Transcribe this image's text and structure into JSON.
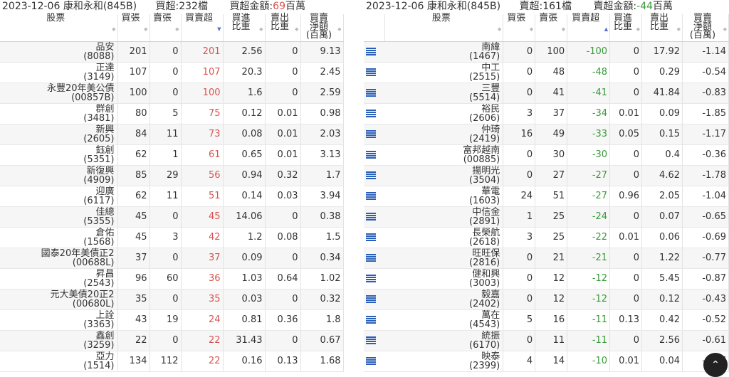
{
  "left": {
    "date": "2023-12-06",
    "broker": "康和永和(845B)",
    "summary": "買超:232檔",
    "amount_label": "買超金額:",
    "amount_value": "69",
    "amount_unit": "百萬",
    "headers": [
      "股票",
      "買張",
      "賣張",
      "買賣超",
      "買進\n比重",
      "賣出\n比重",
      "買賣\n淨額\n(百萬)"
    ],
    "rows": [
      {
        "name": "品安",
        "code": "(8088)",
        "buy": "201",
        "sell": "0",
        "net": "201",
        "buy_ratio": "2.56",
        "sell_ratio": "0",
        "amount": "9.13"
      },
      {
        "name": "正達",
        "code": "(3149)",
        "buy": "107",
        "sell": "0",
        "net": "107",
        "buy_ratio": "20.3",
        "sell_ratio": "0",
        "amount": "2.45"
      },
      {
        "name": "永豐20年美公債",
        "code": "(00857B)",
        "buy": "100",
        "sell": "0",
        "net": "100",
        "buy_ratio": "1.6",
        "sell_ratio": "0",
        "amount": "2.59"
      },
      {
        "name": "群創",
        "code": "(3481)",
        "buy": "80",
        "sell": "5",
        "net": "75",
        "buy_ratio": "0.12",
        "sell_ratio": "0.01",
        "amount": "0.98"
      },
      {
        "name": "新興",
        "code": "(2605)",
        "buy": "84",
        "sell": "11",
        "net": "73",
        "buy_ratio": "0.08",
        "sell_ratio": "0.01",
        "amount": "2.03"
      },
      {
        "name": "鈺創",
        "code": "(5351)",
        "buy": "62",
        "sell": "1",
        "net": "61",
        "buy_ratio": "0.65",
        "sell_ratio": "0.01",
        "amount": "3.13"
      },
      {
        "name": "新復興",
        "code": "(4909)",
        "buy": "85",
        "sell": "29",
        "net": "56",
        "buy_ratio": "0.94",
        "sell_ratio": "0.32",
        "amount": "1.7"
      },
      {
        "name": "迎廣",
        "code": "(6117)",
        "buy": "62",
        "sell": "11",
        "net": "51",
        "buy_ratio": "0.14",
        "sell_ratio": "0.03",
        "amount": "3.94"
      },
      {
        "name": "佳總",
        "code": "(5355)",
        "buy": "45",
        "sell": "0",
        "net": "45",
        "buy_ratio": "14.06",
        "sell_ratio": "0",
        "amount": "0.38"
      },
      {
        "name": "倉佑",
        "code": "(1568)",
        "buy": "45",
        "sell": "3",
        "net": "42",
        "buy_ratio": "1.2",
        "sell_ratio": "0.08",
        "amount": "1.5"
      },
      {
        "name": "國泰20年美債正2",
        "code": "(00688L)",
        "buy": "37",
        "sell": "0",
        "net": "37",
        "buy_ratio": "0.09",
        "sell_ratio": "0",
        "amount": "0.34"
      },
      {
        "name": "昇昌",
        "code": "(2543)",
        "buy": "96",
        "sell": "60",
        "net": "36",
        "buy_ratio": "1.03",
        "sell_ratio": "0.64",
        "amount": "1.02"
      },
      {
        "name": "元大美債20正2",
        "code": "(00680L)",
        "buy": "35",
        "sell": "0",
        "net": "35",
        "buy_ratio": "0.03",
        "sell_ratio": "0",
        "amount": "0.32"
      },
      {
        "name": "上詮",
        "code": "(3363)",
        "buy": "43",
        "sell": "19",
        "net": "24",
        "buy_ratio": "0.81",
        "sell_ratio": "0.36",
        "amount": "1.8"
      },
      {
        "name": "鑫創",
        "code": "(3259)",
        "buy": "22",
        "sell": "0",
        "net": "22",
        "buy_ratio": "31.43",
        "sell_ratio": "0",
        "amount": "0.67"
      },
      {
        "name": "亞力",
        "code": "(1514)",
        "buy": "134",
        "sell": "112",
        "net": "22",
        "buy_ratio": "0.16",
        "sell_ratio": "0.13",
        "amount": "1.68"
      }
    ]
  },
  "right": {
    "date": "2023-12-06",
    "broker": "康和永和(845B)",
    "summary": "賣超:161檔",
    "amount_label": "賣超金額:",
    "amount_value": "-44",
    "amount_unit": "百萬",
    "headers": [
      "股票",
      "買張",
      "賣張",
      "買賣超",
      "買進\n比重",
      "賣出\n比重",
      "買賣\n淨額\n(百萬)"
    ],
    "rows": [
      {
        "name": "南緯",
        "code": "(1467)",
        "buy": "0",
        "sell": "100",
        "net": "-100",
        "buy_ratio": "0",
        "sell_ratio": "17.92",
        "amount": "-1.14"
      },
      {
        "name": "中工",
        "code": "(2515)",
        "buy": "0",
        "sell": "48",
        "net": "-48",
        "buy_ratio": "0",
        "sell_ratio": "0.29",
        "amount": "-0.54"
      },
      {
        "name": "三豐",
        "code": "(5514)",
        "buy": "0",
        "sell": "41",
        "net": "-41",
        "buy_ratio": "0",
        "sell_ratio": "41.84",
        "amount": "-0.83"
      },
      {
        "name": "裕民",
        "code": "(2606)",
        "buy": "3",
        "sell": "37",
        "net": "-34",
        "buy_ratio": "0.01",
        "sell_ratio": "0.09",
        "amount": "-1.85"
      },
      {
        "name": "仲琦",
        "code": "(2419)",
        "buy": "16",
        "sell": "49",
        "net": "-33",
        "buy_ratio": "0.05",
        "sell_ratio": "0.15",
        "amount": "-1.17"
      },
      {
        "name": "富邦越南",
        "code": "(00885)",
        "buy": "0",
        "sell": "30",
        "net": "-30",
        "buy_ratio": "0",
        "sell_ratio": "0.4",
        "amount": "-0.36"
      },
      {
        "name": "揚明光",
        "code": "(3504)",
        "buy": "0",
        "sell": "27",
        "net": "-27",
        "buy_ratio": "0",
        "sell_ratio": "4.62",
        "amount": "-1.78"
      },
      {
        "name": "華電",
        "code": "(1603)",
        "buy": "24",
        "sell": "51",
        "net": "-27",
        "buy_ratio": "0.96",
        "sell_ratio": "2.05",
        "amount": "-1.04"
      },
      {
        "name": "中信金",
        "code": "(2891)",
        "buy": "1",
        "sell": "25",
        "net": "-24",
        "buy_ratio": "0",
        "sell_ratio": "0.07",
        "amount": "-0.65"
      },
      {
        "name": "長榮航",
        "code": "(2618)",
        "buy": "3",
        "sell": "25",
        "net": "-22",
        "buy_ratio": "0.01",
        "sell_ratio": "0.06",
        "amount": "-0.69"
      },
      {
        "name": "旺旺保",
        "code": "(2816)",
        "buy": "0",
        "sell": "21",
        "net": "-21",
        "buy_ratio": "0",
        "sell_ratio": "1.22",
        "amount": "-0.77"
      },
      {
        "name": "健和興",
        "code": "(3003)",
        "buy": "0",
        "sell": "12",
        "net": "-12",
        "buy_ratio": "0",
        "sell_ratio": "5.45",
        "amount": "-0.87"
      },
      {
        "name": "毅嘉",
        "code": "(2402)",
        "buy": "0",
        "sell": "12",
        "net": "-12",
        "buy_ratio": "0",
        "sell_ratio": "0.12",
        "amount": "-0.43"
      },
      {
        "name": "萬在",
        "code": "(4543)",
        "buy": "5",
        "sell": "16",
        "net": "-11",
        "buy_ratio": "0.13",
        "sell_ratio": "0.42",
        "amount": "-0.52"
      },
      {
        "name": "統振",
        "code": "(6170)",
        "buy": "0",
        "sell": "11",
        "net": "-11",
        "buy_ratio": "0",
        "sell_ratio": "2.56",
        "amount": "-0.61"
      },
      {
        "name": "映泰",
        "code": "(2399)",
        "buy": "4",
        "sell": "14",
        "net": "-10",
        "buy_ratio": "0.01",
        "sell_ratio": "0.04",
        "amount": "-0.27"
      }
    ]
  },
  "colors": {
    "buy_net": "#d9534f",
    "sell_net": "#3a9a3a",
    "list_icon": "#2a5fb8"
  },
  "icons": {
    "row_icon": "list-icon",
    "scroll_top": "chevron-up-icon",
    "sort": "sort-arrows-icon"
  }
}
